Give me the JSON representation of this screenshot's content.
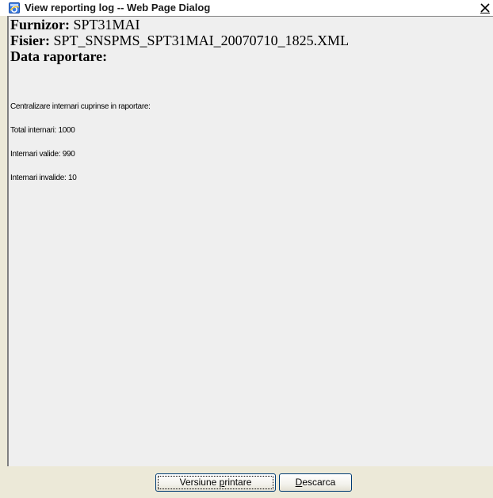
{
  "window": {
    "title": "View reporting log -- Web Page Dialog",
    "close_label": "X"
  },
  "header": {
    "supplier_label": "Furnizor:",
    "supplier_value": "SPT31MAI",
    "file_label": "Fisier:",
    "file_value": "SPT_SNSPMS_SPT31MAI_20070710_1825.XML",
    "report_date_label": "Data raportare:",
    "report_date_value": ""
  },
  "summary": {
    "heading": "Centralizare internari cuprinse in raportare:",
    "total_label": "Total internari:",
    "total_value": "1000",
    "valid_label": "Internari valide:",
    "valid_value": "990",
    "invalid_label": "Internari invalide:",
    "invalid_value": "10"
  },
  "buttons": {
    "print": {
      "label_before": "Versiune ",
      "label_accel": "p",
      "label_after": "rintare"
    },
    "download": {
      "label_before": "",
      "label_accel": "D",
      "label_after": "escarca"
    }
  },
  "icons": {
    "title": "ie-page-icon",
    "close": "close-icon"
  },
  "colors": {
    "dialog_background": "#ece9d8",
    "content_background": "#efefef",
    "button_border": "#003c74"
  }
}
